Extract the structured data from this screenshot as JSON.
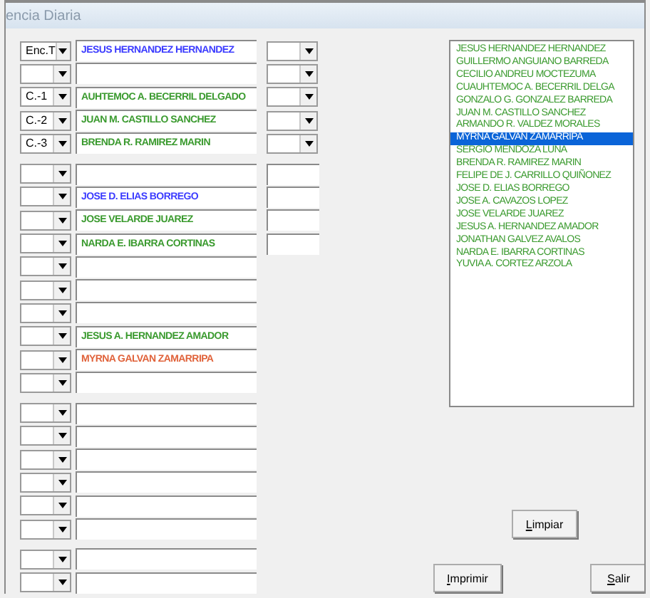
{
  "window": {
    "title": "encia Diaria"
  },
  "sections": [
    [
      {
        "code": "Enc.T",
        "name": "JESUS HERNANDEZ HERNANDEZ",
        "color": "#3b3bff",
        "kind": "with_combo"
      },
      {
        "kind": "with_combo"
      },
      {
        "code": "C.-1",
        "name": "AUHTEMOC A. BECERRIL DELGADO",
        "color": "#3a9a2e",
        "kind": "with_combo"
      },
      {
        "code": "C.-2",
        "name": "JUAN M. CASTILLO SANCHEZ",
        "color": "#3a9a2e",
        "kind": "with_combo"
      },
      {
        "code": "C.-3",
        "name": "BRENDA R. RAMIREZ MARIN",
        "color": "#3a9a2e",
        "kind": "with_combo"
      }
    ],
    [
      {
        "kind": "with_field"
      },
      {
        "name": "JOSE D. ELIAS BORREGO",
        "color": "#3b3bff",
        "kind": "with_field"
      },
      {
        "name": "JOSE VELARDE JUAREZ",
        "color": "#3a9a2e",
        "kind": "with_field"
      },
      {
        "name": "NARDA E. IBARRA CORTINAS",
        "color": "#3a9a2e",
        "kind": "with_field"
      },
      {
        "kind": "plain"
      },
      {
        "kind": "plain"
      },
      {
        "kind": "plain"
      },
      {
        "name": "JESUS A. HERNANDEZ AMADOR",
        "color": "#3a9a2e",
        "kind": "plain"
      },
      {
        "name": "MYRNA GALVAN ZAMARRIPA",
        "color": "#e0623a",
        "kind": "plain"
      },
      {
        "kind": "plain"
      }
    ],
    [
      {
        "kind": "plain"
      },
      {
        "kind": "plain"
      },
      {
        "kind": "plain"
      },
      {
        "kind": "plain"
      },
      {
        "kind": "plain"
      },
      {
        "kind": "plain"
      }
    ],
    [
      {
        "kind": "plain"
      },
      {
        "kind": "plain"
      }
    ]
  ],
  "list": [
    {
      "label": "JESUS HERNANDEZ HERNANDEZ",
      "selected": false
    },
    {
      "label": "GUILLERMO ANGUIANO BARREDA",
      "selected": false
    },
    {
      "label": "CECILIO ANDREU MOCTEZUMA",
      "selected": false
    },
    {
      "label": "CUAUHTEMOC A. BECERRIL DELGA",
      "selected": false
    },
    {
      "label": "GONZALO G. GONZALEZ BARREDA",
      "selected": false
    },
    {
      "label": "JUAN M. CASTILLO SANCHEZ",
      "selected": false
    },
    {
      "label": "ARMANDO R. VALDEZ MORALES",
      "selected": false
    },
    {
      "label": "MYRNA GALVAN ZAMARRIPA",
      "selected": true
    },
    {
      "label": "SERGIO MENDOZA LUNA",
      "selected": false
    },
    {
      "label": "BRENDA R. RAMIREZ MARIN",
      "selected": false
    },
    {
      "label": "FELIPE DE J. CARRILLO QUIÑONEZ",
      "selected": false
    },
    {
      "label": "JOSE D. ELIAS BORREGO",
      "selected": false
    },
    {
      "label": "JOSE A. CAVAZOS LOPEZ",
      "selected": false
    },
    {
      "label": "JOSE VELARDE JUAREZ",
      "selected": false
    },
    {
      "label": "JESUS A. HERNANDEZ AMADOR",
      "selected": false
    },
    {
      "label": "JONATHAN GALVEZ AVALOS",
      "selected": false
    },
    {
      "label": "NARDA E. IBARRA CORTINAS",
      "selected": false
    },
    {
      "label": "YUVIA A. CORTEZ ARZOLA",
      "selected": false
    }
  ],
  "buttons": {
    "clear": "Limpiar",
    "print": "Imprimir",
    "exit": "Salir"
  }
}
